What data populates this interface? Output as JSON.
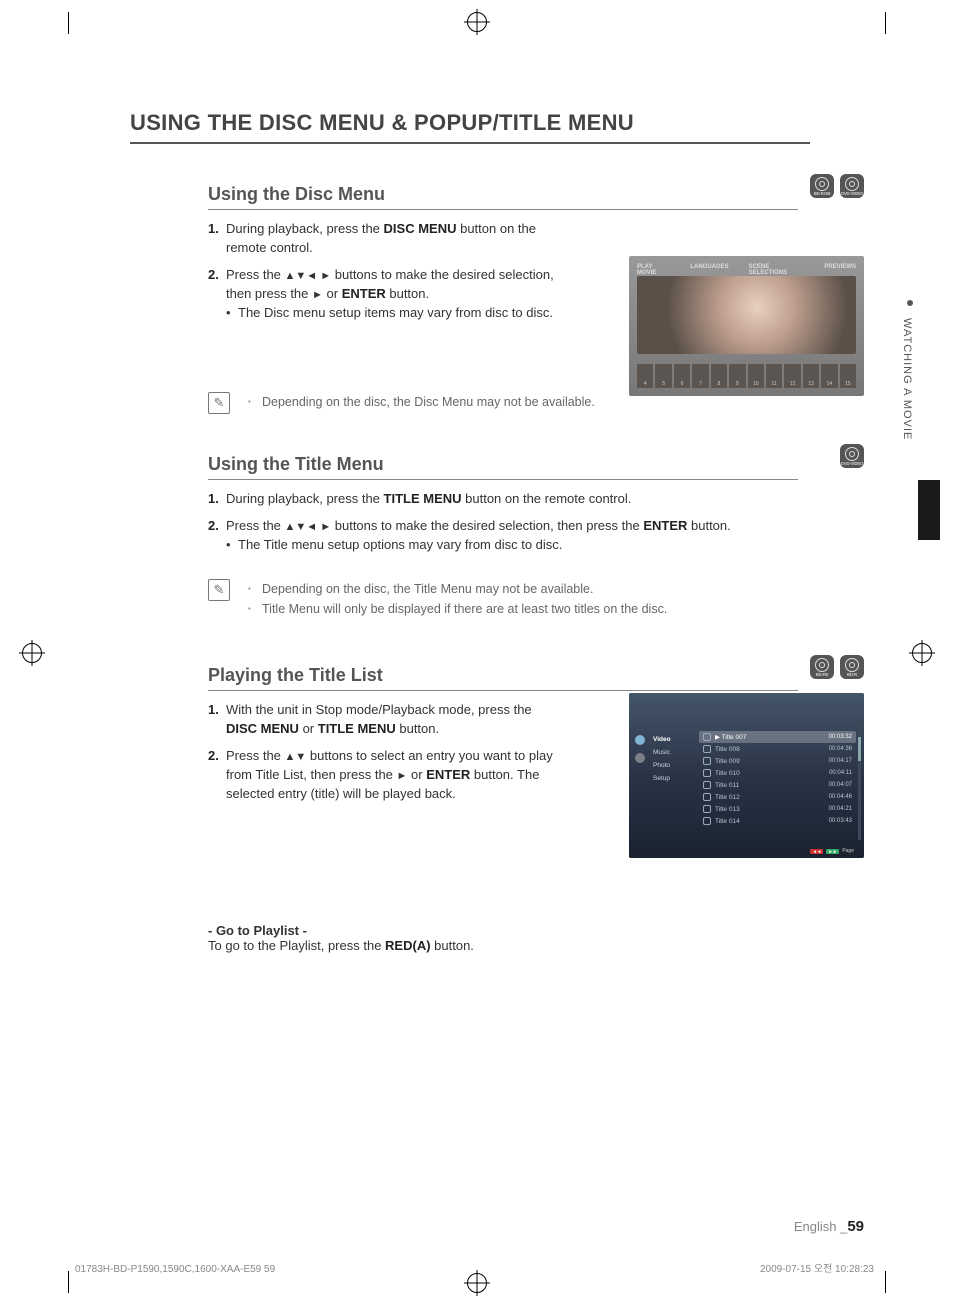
{
  "page": {
    "title": "USING THE DISC MENU & POPUP/TITLE MENU",
    "side_tab": "WATCHING A MOVIE",
    "footer_lang": "English",
    "footer_page_pre": "_",
    "footer_page": "59",
    "footer_file": "01783H-BD-P1590,1590C,1600-XAA-E59   59",
    "footer_date": "2009-07-15   오전 10:28:23"
  },
  "icons": {
    "bd_rom": "BD-ROM",
    "dvd_video": "DVD-VIDEO",
    "bd_re": "BD-RE",
    "bd_r": "BD-R"
  },
  "s1": {
    "heading": "Using the Disc Menu",
    "step1_pre": "During playback, press the ",
    "step1_b": "DISC MENU",
    "step1_post": " button on the remote control.",
    "step2_pre": "Press the ",
    "step2_mid": " buttons to make the desired selection, then press the ",
    "or": " or ",
    "enter": "ENTER",
    "step2_post": " button.",
    "step2_sub": "The Disc menu setup items may vary from disc to disc.",
    "note1": "Depending on the disc, the Disc Menu may not be available."
  },
  "s2": {
    "heading": "Using the Title Menu",
    "step1_pre": "During playback, press the ",
    "step1_b": "TITLE MENU",
    "step1_post": " button on the remote control.",
    "step2_pre": "Press the ",
    "step2_mid": " buttons to make the desired selection, then press the ",
    "enter": "ENTER",
    "step2_post": " button.",
    "step2_sub": "The Title menu setup options may vary from disc to disc.",
    "note1": "Depending on the disc, the Title Menu may not be available.",
    "note2": "Title Menu will only be displayed if there are at least two titles on the disc."
  },
  "s3": {
    "heading": "Playing the Title List",
    "step1_pre": "With the unit in Stop mode/Playback mode, press the ",
    "step1_b1": "DISC MENU",
    "or": " or ",
    "step1_b2": "TITLE MENU",
    "step1_post": " button.",
    "step2_pre": "Press the ",
    "step2_mid": " buttons to select an entry you want to play from Title List, then press the ",
    "step2_or": " or ",
    "enter": "ENTER",
    "step2_post": " button. The selected entry (title) will be played back.",
    "goto_h": "- Go to Playlist -",
    "goto_pre": "To go to the Playlist, press the ",
    "goto_b": "RED(A)",
    "goto_post": " button."
  },
  "shot1": {
    "tabs": [
      "PLAY MOVIE",
      "LANGUAGES",
      "SCENE SELECTIONS",
      "PREVIEWS"
    ],
    "thumbs": [
      "4",
      "5",
      "6",
      "7",
      "8",
      "9",
      "10",
      "11",
      "12",
      "13",
      "14",
      "15"
    ]
  },
  "shot3": {
    "cats": [
      {
        "label": "Video",
        "sel": true
      },
      {
        "label": "Music",
        "sel": false
      },
      {
        "label": "Photo",
        "sel": false
      },
      {
        "label": "Setup",
        "sel": false
      }
    ],
    "rows": [
      {
        "t": "Title 007",
        "d": "00:03:32",
        "sel": true,
        "mark": "▶"
      },
      {
        "t": "Title 008",
        "d": "00:04:36",
        "sel": false
      },
      {
        "t": "Title 009",
        "d": "00:04:17",
        "sel": false
      },
      {
        "t": "Title 010",
        "d": "00:04:11",
        "sel": false
      },
      {
        "t": "Title 011",
        "d": "00:04:07",
        "sel": false
      },
      {
        "t": "Title 012",
        "d": "00:04:46",
        "sel": false
      },
      {
        "t": "Title 013",
        "d": "00:04:21",
        "sel": false
      },
      {
        "t": "Title 014",
        "d": "00:03:43",
        "sel": false
      }
    ],
    "page_label": "Page"
  }
}
